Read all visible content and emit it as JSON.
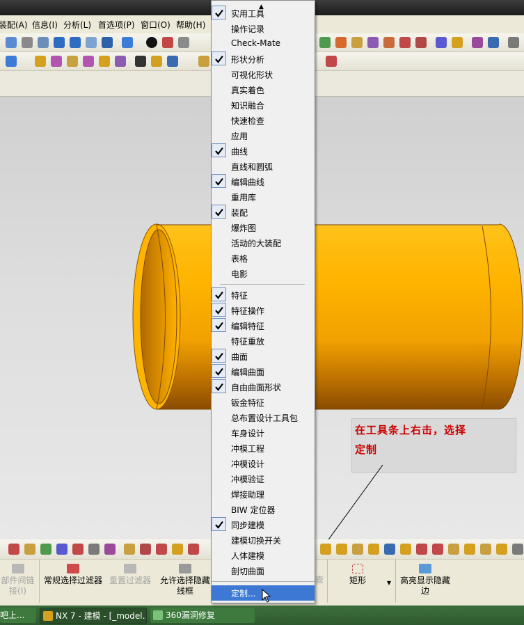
{
  "menubar": {
    "items": [
      {
        "label": "装配(A)"
      },
      {
        "label": "信息(I)"
      },
      {
        "label": "分析(L)"
      },
      {
        "label": "首选项(P)"
      },
      {
        "label": "窗口(O)"
      },
      {
        "label": "帮助(H)"
      }
    ]
  },
  "context_menu": {
    "scroll_up_glyph": "▲",
    "items": [
      {
        "label": "实用工具",
        "checked": true
      },
      {
        "label": "操作记录",
        "checked": false
      },
      {
        "label": "Check-Mate",
        "checked": false
      },
      {
        "label": "形状分析",
        "checked": true
      },
      {
        "label": "可视化形状",
        "checked": false
      },
      {
        "label": "真实着色",
        "checked": false
      },
      {
        "label": "知识融合",
        "checked": false
      },
      {
        "label": "快速检查",
        "checked": false
      },
      {
        "label": "应用",
        "checked": false
      },
      {
        "label": "曲线",
        "checked": true
      },
      {
        "label": "直线和圆弧",
        "checked": false
      },
      {
        "label": "编辑曲线",
        "checked": true
      },
      {
        "label": "重用库",
        "checked": false
      },
      {
        "label": "装配",
        "checked": true
      },
      {
        "label": "爆炸图",
        "checked": false
      },
      {
        "label": "活动的大装配",
        "checked": false
      },
      {
        "label": "表格",
        "checked": false
      },
      {
        "label": "电影",
        "checked": false
      },
      {
        "label": "特征",
        "checked": true
      },
      {
        "label": "特征操作",
        "checked": true
      },
      {
        "label": "编辑特征",
        "checked": true
      },
      {
        "label": "特征重放",
        "checked": false
      },
      {
        "label": "曲面",
        "checked": true
      },
      {
        "label": "编辑曲面",
        "checked": true
      },
      {
        "label": "自由曲面形状",
        "checked": true
      },
      {
        "label": "钣金特征",
        "checked": false
      },
      {
        "label": "总布置设计工具包",
        "checked": false
      },
      {
        "label": "车身设计",
        "checked": false
      },
      {
        "label": "冲模工程",
        "checked": false
      },
      {
        "label": "冲模设计",
        "checked": false
      },
      {
        "label": "冲模验证",
        "checked": false
      },
      {
        "label": "焊接助理",
        "checked": false
      },
      {
        "label": "BIW 定位器",
        "checked": false
      },
      {
        "label": "同步建模",
        "checked": true
      },
      {
        "label": "建模切换开关",
        "checked": false
      },
      {
        "label": "人体建模",
        "checked": false
      },
      {
        "label": "剖切曲面",
        "checked": false
      }
    ],
    "customize_label": "定制..."
  },
  "annotation": {
    "line1": "在工具条上右击，选择",
    "line2": "定制"
  },
  "selection_bar": {
    "part_link": "部件间链接(I)",
    "general_filter": "常规选择过滤器",
    "reset_filter": "重置过滤器",
    "allow_hidden": "允许选择隐藏线框",
    "partial": "查",
    "rectangle": "矩形",
    "highlight_hidden": "高亮显示隐藏边"
  },
  "taskbar": {
    "item1": "吧上...",
    "item2": "NX 7 - 建模 - [_model...",
    "item3": "360漏洞修复"
  },
  "colors": {
    "cylinder": "#ffb800",
    "highlight": "#3d79d4",
    "annotation_text": "#cc0000"
  }
}
